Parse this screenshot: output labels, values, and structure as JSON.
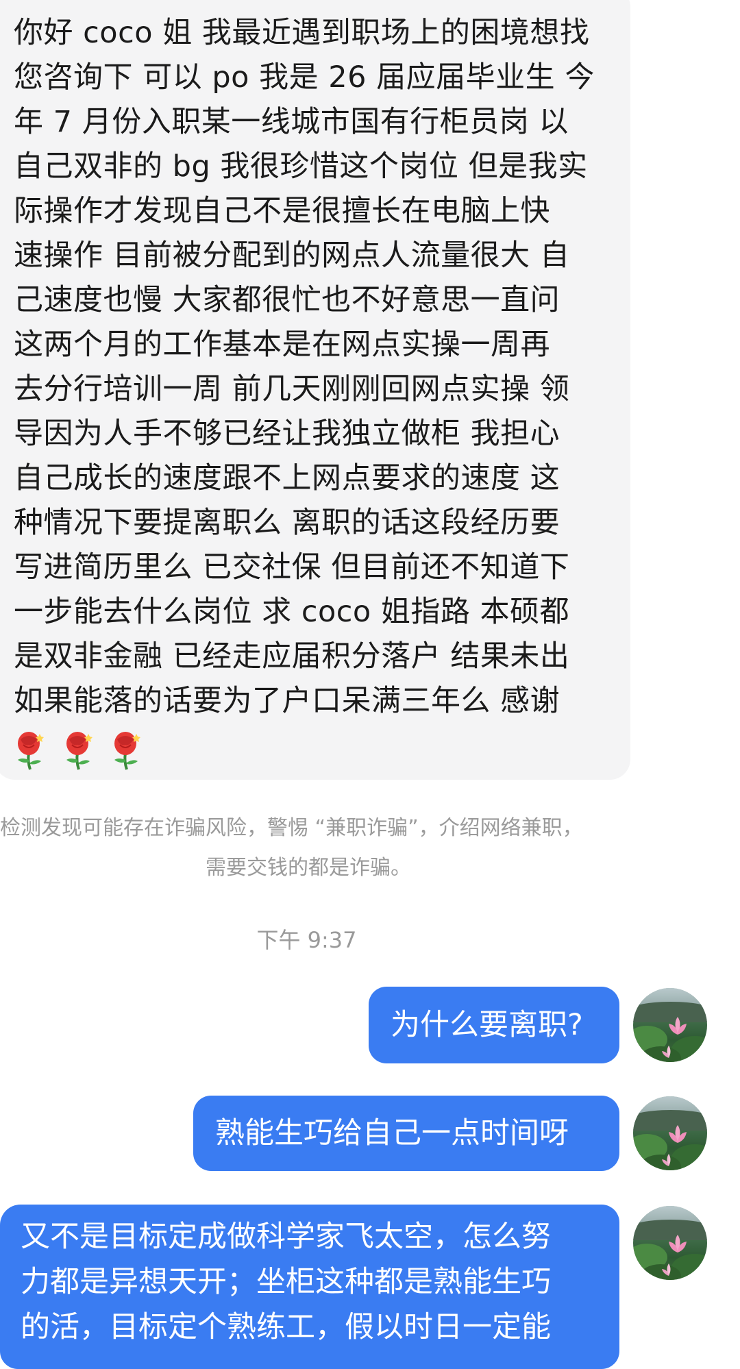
{
  "incoming_message": {
    "lines": [
      "你好 coco 姐  我最近遇到职场上的困境想找",
      "您咨询下  可以 po  我是 26 届应届毕业生  今",
      "年 7 月份入职某一线城市国有行柜员岗  以",
      "自己双非的 bg 我很珍惜这个岗位  但是我实",
      "际操作才发现自己不是很擅长在电脑上快",
      "速操作  目前被分配到的网点人流量很大  自",
      "己速度也慢  大家都很忙也不好意思一直问",
      "这两个月的工作基本是在网点实操一周再",
      "去分行培训一周  前几天刚刚回网点实操  领",
      "导因为人手不够已经让我独立做柜  我担心",
      "自己成长的速度跟不上网点要求的速度  这",
      "种情况下要提离职么  离职的话这段经历要",
      "写进简历里么  已交社保  但目前还不知道下",
      "一步能去什么岗位  求 coco 姐指路  本硕都",
      "是双非金融  已经走应届积分落户  结果未出",
      "如果能落的话要为了户口呆满三年么  感谢"
    ],
    "emoji": [
      "rose-icon",
      "rose-icon",
      "rose-icon"
    ]
  },
  "system_notice": {
    "line1": "检测发现可能存在诈骗风险，警惕 “兼职诈骗”，介绍网络兼职，",
    "line2": "需要交钱的都是诈骗。"
  },
  "timestamp": "下午 9:37",
  "outgoing_messages": [
    {
      "text": "为什么要离职?"
    },
    {
      "text": "熟能生巧给自己一点时间呀"
    },
    {
      "lines": [
        "又不是目标定成做科学家飞太空，怎么努",
        "力都是异想天开；坐柜这种都是熟能生巧",
        "的活，目标定个熟练工，假以时日一定能"
      ]
    }
  ],
  "colors": {
    "incoming_bubble": "#f4f4f5",
    "outgoing_bubble": "#3a7cf2",
    "notice_text": "#9a9a9a"
  }
}
